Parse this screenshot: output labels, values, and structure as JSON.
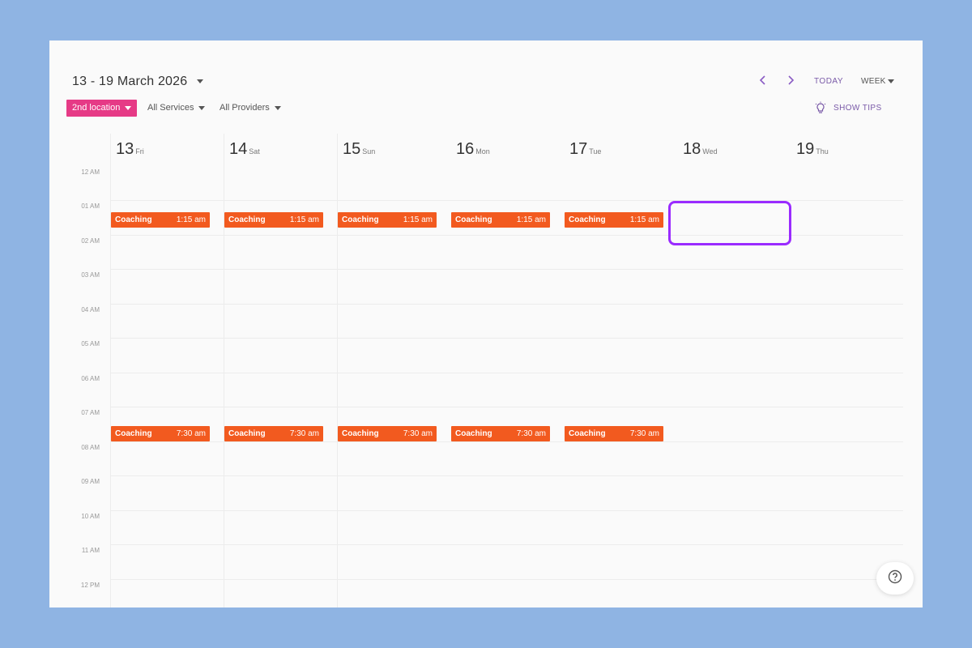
{
  "header": {
    "date_range": "13 - 19 March 2026",
    "today_label": "TODAY",
    "view_label": "WEEK",
    "tips_label": "SHOW TIPS"
  },
  "filters": {
    "location": "2nd location",
    "services": "All Services",
    "providers": "All Providers"
  },
  "days": [
    {
      "num": "13",
      "name": "Fri"
    },
    {
      "num": "14",
      "name": "Sat"
    },
    {
      "num": "15",
      "name": "Sun"
    },
    {
      "num": "16",
      "name": "Mon"
    },
    {
      "num": "17",
      "name": "Tue"
    },
    {
      "num": "18",
      "name": "Wed"
    },
    {
      "num": "19",
      "name": "Thu"
    }
  ],
  "hours": [
    "12 AM",
    "01 AM",
    "02 AM",
    "03 AM",
    "04 AM",
    "05 AM",
    "06 AM",
    "07 AM",
    "08 AM",
    "09 AM",
    "10 AM",
    "11 AM",
    "12 PM"
  ],
  "events": {
    "morning": {
      "name": "Coaching",
      "time": "1:15 am"
    },
    "later": {
      "name": "Coaching",
      "time": "7:30 am"
    }
  },
  "colors": {
    "event": "#f25a1f",
    "location_button": "#e63a86",
    "accent": "#7a5aa8",
    "highlight": "#9a2bff"
  },
  "icons": {
    "prev": "chevron-left-icon",
    "next": "chevron-right-icon",
    "tips": "lightbulb-icon",
    "help": "question-circle-icon"
  }
}
